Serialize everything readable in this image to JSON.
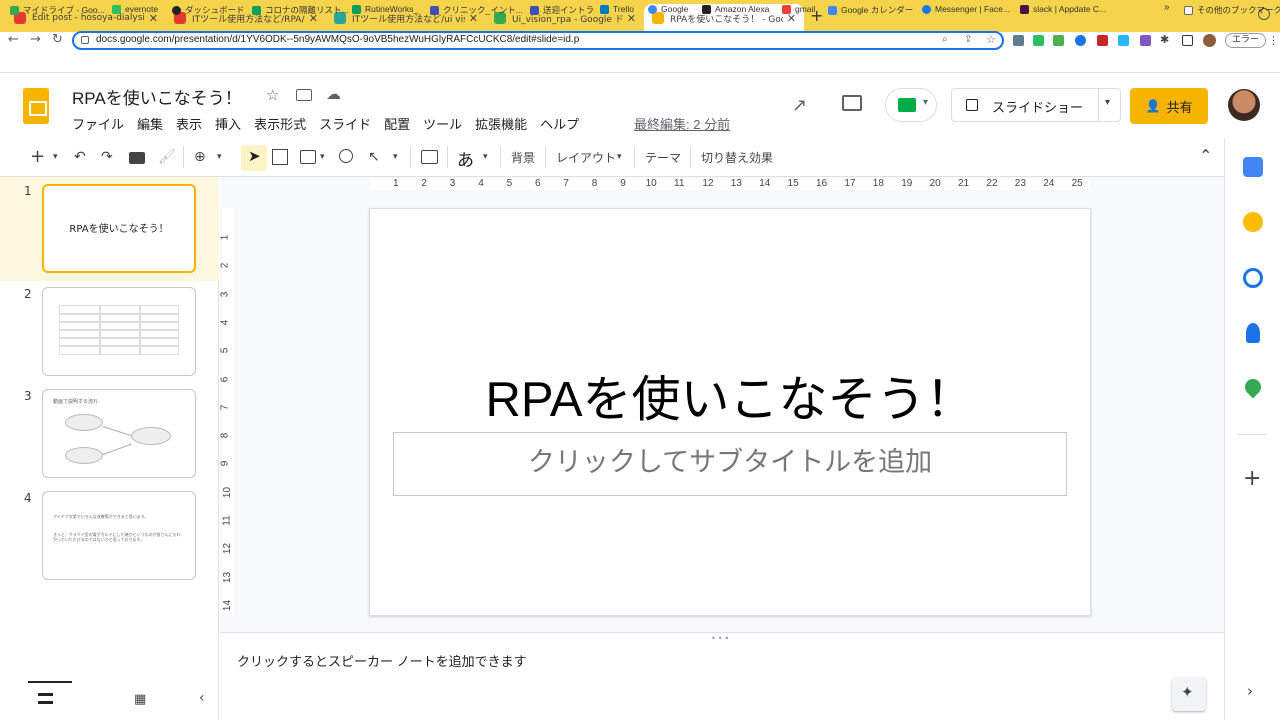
{
  "browser": {
    "tabs": [
      {
        "label": "Edit post - hosoya-dialysis.esa",
        "favicon_color": "#e53935"
      },
      {
        "label": "ITツール使用方法など/RPA/ui vis",
        "favicon_color": "#e53935"
      },
      {
        "label": "ITツール使用方法など/ui vision rp",
        "favicon_color": "#26a69a"
      },
      {
        "label": "Ui_vision_rpa - Google ドライ",
        "favicon_color": "#34a853"
      },
      {
        "label": "RPAを使いこなそう！ - Google",
        "favicon_color": "#f4b400",
        "active": true
      }
    ],
    "new_tab": "+",
    "url": "docs.google.com/presentation/d/1YV6ODK--5n9yAWMQsO-9oVB5hezWuHGlyRAFCcUCKC8/edit#slide=id.p",
    "error_button": "エラー",
    "bookmarks": [
      {
        "label": "マイドライブ - Goo...",
        "color": "#34a853"
      },
      {
        "label": "evernote",
        "color": "#2dbe60"
      },
      {
        "label": "ダッシュボード",
        "color": "#222222"
      },
      {
        "label": "コロナの隔離リスト...",
        "color": "#0f9d58"
      },
      {
        "label": "RutineWorks_",
        "color": "#0f9d58"
      },
      {
        "label": "クリニック_イント...",
        "color": "#3f51b5"
      },
      {
        "label": "送迎イントラ",
        "color": "#3f51b5"
      },
      {
        "label": "Trello",
        "color": "#0079bf"
      },
      {
        "label": "Google",
        "color": "#4285f4"
      },
      {
        "label": "Amazon Alexa",
        "color": "#222222"
      },
      {
        "label": "gmail",
        "color": "#ea4335"
      },
      {
        "label": "Google カレンダー",
        "color": "#4285f4"
      },
      {
        "label": "Messenger | Face...",
        "color": "#1877f2"
      },
      {
        "label": "slack | Appdate C...",
        "color": "#4a154b"
      }
    ],
    "bookmarks_overflow": "»",
    "other_bookmarks": "その他のブックマーク"
  },
  "header": {
    "doc_title": "RPAを使いこなそう！",
    "menus": [
      "ファイル",
      "編集",
      "表示",
      "挿入",
      "表示形式",
      "スライド",
      "配置",
      "ツール",
      "拡張機能",
      "ヘルプ"
    ],
    "last_edit": "最終編集: 2 分前",
    "slideshow_label": "スライドショー",
    "share_label": "共有"
  },
  "toolbar": {
    "background_label": "背景",
    "layout_label": "レイアウト",
    "theme_label": "テーマ",
    "transition_label": "切り替え効果",
    "input_mode": "あ"
  },
  "filmstrip": {
    "slides": [
      {
        "number": "1",
        "title": "RPAを使いこなそう！"
      },
      {
        "number": "2"
      },
      {
        "number": "3",
        "title": "動画で説明する流れ"
      },
      {
        "number": "4",
        "text1": "アイデア次第でいろんな改善策ができると思います。",
        "text2": "きっと、クラウド型の電子カルテにした暁かというものが皆さんにもわかっていただけるのではないかと思っております。"
      }
    ]
  },
  "ruler": {
    "h": [
      "1",
      "2",
      "3",
      "4",
      "5",
      "6",
      "7",
      "8",
      "9",
      "10",
      "11",
      "12",
      "13",
      "14",
      "15",
      "16",
      "17",
      "18",
      "19",
      "20",
      "21",
      "22",
      "23",
      "24",
      "25"
    ],
    "v": [
      "1",
      "2",
      "3",
      "4",
      "5",
      "6",
      "7",
      "8",
      "9",
      "10",
      "11",
      "12",
      "13",
      "14"
    ]
  },
  "slide": {
    "title": "RPAを使いこなそう！",
    "subtitle_placeholder": "クリックしてサブタイトルを追加"
  },
  "notes": {
    "placeholder": "クリックするとスピーカー ノートを追加できます"
  },
  "colors": {
    "accent": "#f4b400",
    "tabbar": "#f5d44b",
    "focus": "#1a73e8"
  }
}
